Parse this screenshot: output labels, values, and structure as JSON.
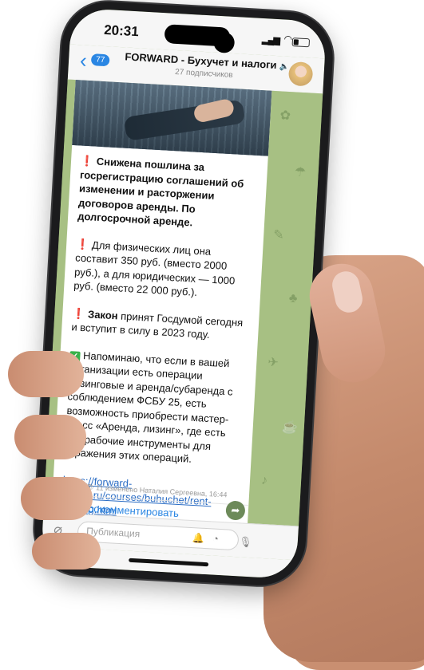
{
  "status_bar": {
    "time": "20:31"
  },
  "header": {
    "back_count": "77",
    "channel_title": "FORWARD - Бухучет и налоги",
    "subscribers": "27 подписчиков"
  },
  "post": {
    "headline": "Снижена пошлина за госрегистрацию соглашений об изменении и расторжении договоров аренды. По долгосрочной аренде.",
    "paragraph_fees": "Для физических лиц она составит 350 руб. (вместо 2000 руб.), а для юридических — 1000 руб. (вместо 22 000 руб.).",
    "law_bold": "Закон",
    "law_text": " принят Госдумой сегодня и вступит в силу в 2023 году.",
    "reminder": "Напоминаю, что если в вашей организации есть операции лизинговые и аренда/субаренда с соблюдением ФСБУ 25, есть возможность приобрести мастер-класс «Аренда, лизинг», где есть все рабочие инструменты для отражения этих операций.",
    "link": "https://forward-center.ru/courses/buhuchet/rent-leasing.html",
    "meta": "11 изменено Наталия Сергеевна, 16:44"
  },
  "comment_button": {
    "label": "Прокомментировать"
  },
  "composer": {
    "placeholder": "Публикация"
  },
  "icons": {
    "back": "chevron-left-icon",
    "mute": "muted-speaker-icon",
    "attach": "paperclip-icon",
    "notify": "bell-icon",
    "timer": "clock-icon",
    "mic": "microphone-icon",
    "comment": "speech-bubble-icon",
    "share": "share-arrow-icon"
  },
  "colors": {
    "accent": "#2a86e3",
    "warning": "#e5332a",
    "check": "#38b24a",
    "chat_bg": "#a7c083"
  }
}
